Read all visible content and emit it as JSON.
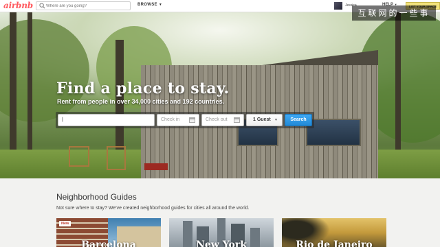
{
  "nav": {
    "logo": "airbnb",
    "search_placeholder": "Where are you going?",
    "browse": "BROWSE",
    "user_name": "Jessica",
    "help": "HELP",
    "list_space": "LIST YOUR SPACE"
  },
  "watermark": "互联网的一些事",
  "hero": {
    "title": "Find a place to stay.",
    "subtitle": "Rent from people in over 34,000 cities and 192 countries.",
    "where_value": "",
    "checkin_placeholder": "Check in",
    "checkout_placeholder": "Check out",
    "guests": "1 Guest",
    "search_button": "Search"
  },
  "neighborhoods": {
    "title": "Neighborhood Guides",
    "subtitle": "Not sure where to stay? We've created neighborhood guides for cities all around the world.",
    "cards": [
      {
        "name": "Barcelona",
        "badge": "New"
      },
      {
        "name": "New York"
      },
      {
        "name": "Rio de Janeiro"
      }
    ]
  },
  "colors": {
    "brand": "#ff5a5f",
    "search_button": "#2289d6",
    "list_space": "#f3e37d"
  }
}
